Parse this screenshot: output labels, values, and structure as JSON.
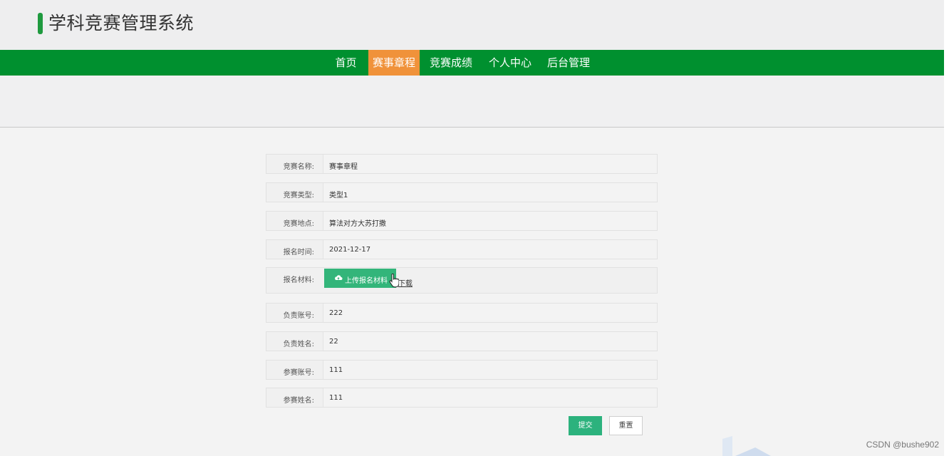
{
  "header": {
    "title": "学科竞赛管理系统"
  },
  "nav": {
    "items": [
      {
        "label": "首页",
        "active": false
      },
      {
        "label": "赛事章程",
        "active": true
      },
      {
        "label": "竞赛成绩",
        "active": false
      },
      {
        "label": "个人中心",
        "active": false
      },
      {
        "label": "后台管理",
        "active": false
      }
    ]
  },
  "form": {
    "fields": [
      {
        "label": "竞赛名称:",
        "value": "赛事章程"
      },
      {
        "label": "竞赛类型:",
        "value": "类型1"
      },
      {
        "label": "竞赛地点:",
        "value": "算法对方大苏打撒"
      },
      {
        "label": "报名时间:",
        "value": "2021-12-17"
      },
      {
        "label": "报名材料:",
        "upload_label": "上传报名材料",
        "download_label": "下载"
      },
      {
        "label": "负责账号:",
        "value": "222"
      },
      {
        "label": "负责姓名:",
        "value": "22"
      },
      {
        "label": "参赛账号:",
        "value": "111"
      },
      {
        "label": "参赛姓名:",
        "value": "111"
      }
    ],
    "submit_label": "提交",
    "reset_label": "重置"
  },
  "watermark": "CSDN @bushe902",
  "colors": {
    "nav_bg": "#00902f",
    "nav_active": "#f0923a",
    "button_green": "#2cb27d",
    "accent_bar": "#1f9a3f"
  },
  "icons": {
    "upload": "cloud-upload-icon",
    "cursor": "hand-pointer-cursor"
  }
}
